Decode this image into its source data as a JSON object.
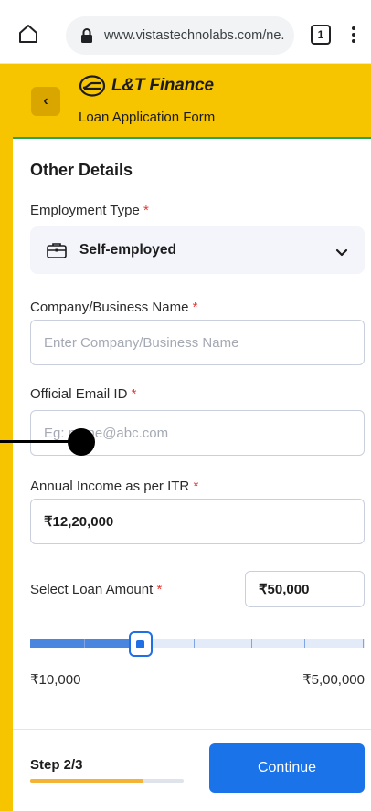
{
  "browser": {
    "url": "www.vistastechnolabs.com/ne.",
    "tab_count": "1",
    "icons": [
      "home-icon",
      "lock-icon",
      "tabs-icon",
      "more-vert-icon"
    ]
  },
  "header": {
    "brand_name": "L&T Finance",
    "form_title": "Loan Application Form",
    "back_glyph": "‹",
    "colors": {
      "header_bg": "#f7c400",
      "accent_border": "#28a35a"
    }
  },
  "form": {
    "section_title": "Other Details",
    "required_mark": "*",
    "employment_type": {
      "label": "Employment Type",
      "value": "Self-employed"
    },
    "company_name": {
      "label": "Company/Business Name",
      "placeholder": "Enter Company/Business Name",
      "value": ""
    },
    "official_email": {
      "label": "Official Email ID",
      "placeholder": "Eg: name@abc.com",
      "value": ""
    },
    "annual_income": {
      "label": "Annual Income as per ITR",
      "value": "₹12,20,000"
    },
    "loan_amount": {
      "label": "Select Loan Amount",
      "value": "₹50,000",
      "min_label": "₹10,000",
      "max_label": "₹5,00,000",
      "slider_fraction": 0.33,
      "tick_fractions": [
        0.16,
        0.49,
        0.66,
        0.82,
        0.995
      ]
    }
  },
  "footer": {
    "step_label": "Step 2/3",
    "step_progress": 0.74,
    "continue_label": "Continue",
    "colors": {
      "primary": "#1a73e8",
      "progress": "#f5b335"
    }
  }
}
